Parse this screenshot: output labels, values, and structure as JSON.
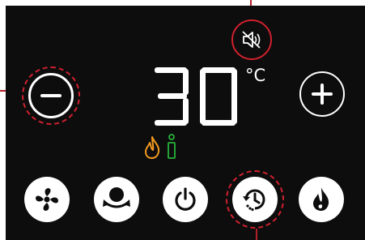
{
  "display": {
    "temperature": "30",
    "unit": "°C"
  },
  "indicators": {
    "flame_icon": "flame-outline-icon",
    "flame_color": "#f39a1e",
    "info_icon": "info-icon",
    "info_color": "#28b33a"
  },
  "buttons": [
    {
      "name": "decrease-button",
      "icon": "minus-icon"
    },
    {
      "name": "increase-button",
      "icon": "plus-icon"
    },
    {
      "name": "fan-button",
      "icon": "fan-icon"
    },
    {
      "name": "oscillation-button",
      "icon": "oscillate-icon"
    },
    {
      "name": "power-button",
      "icon": "power-icon"
    },
    {
      "name": "timer-button",
      "icon": "timer-icon"
    },
    {
      "name": "heat-button",
      "icon": "flame-icon"
    },
    {
      "name": "mute-button",
      "icon": "sound-off-icon"
    }
  ],
  "colors": {
    "panel": "#0d0d0d",
    "foreground": "#ffffff",
    "highlight": "#d0202e"
  }
}
